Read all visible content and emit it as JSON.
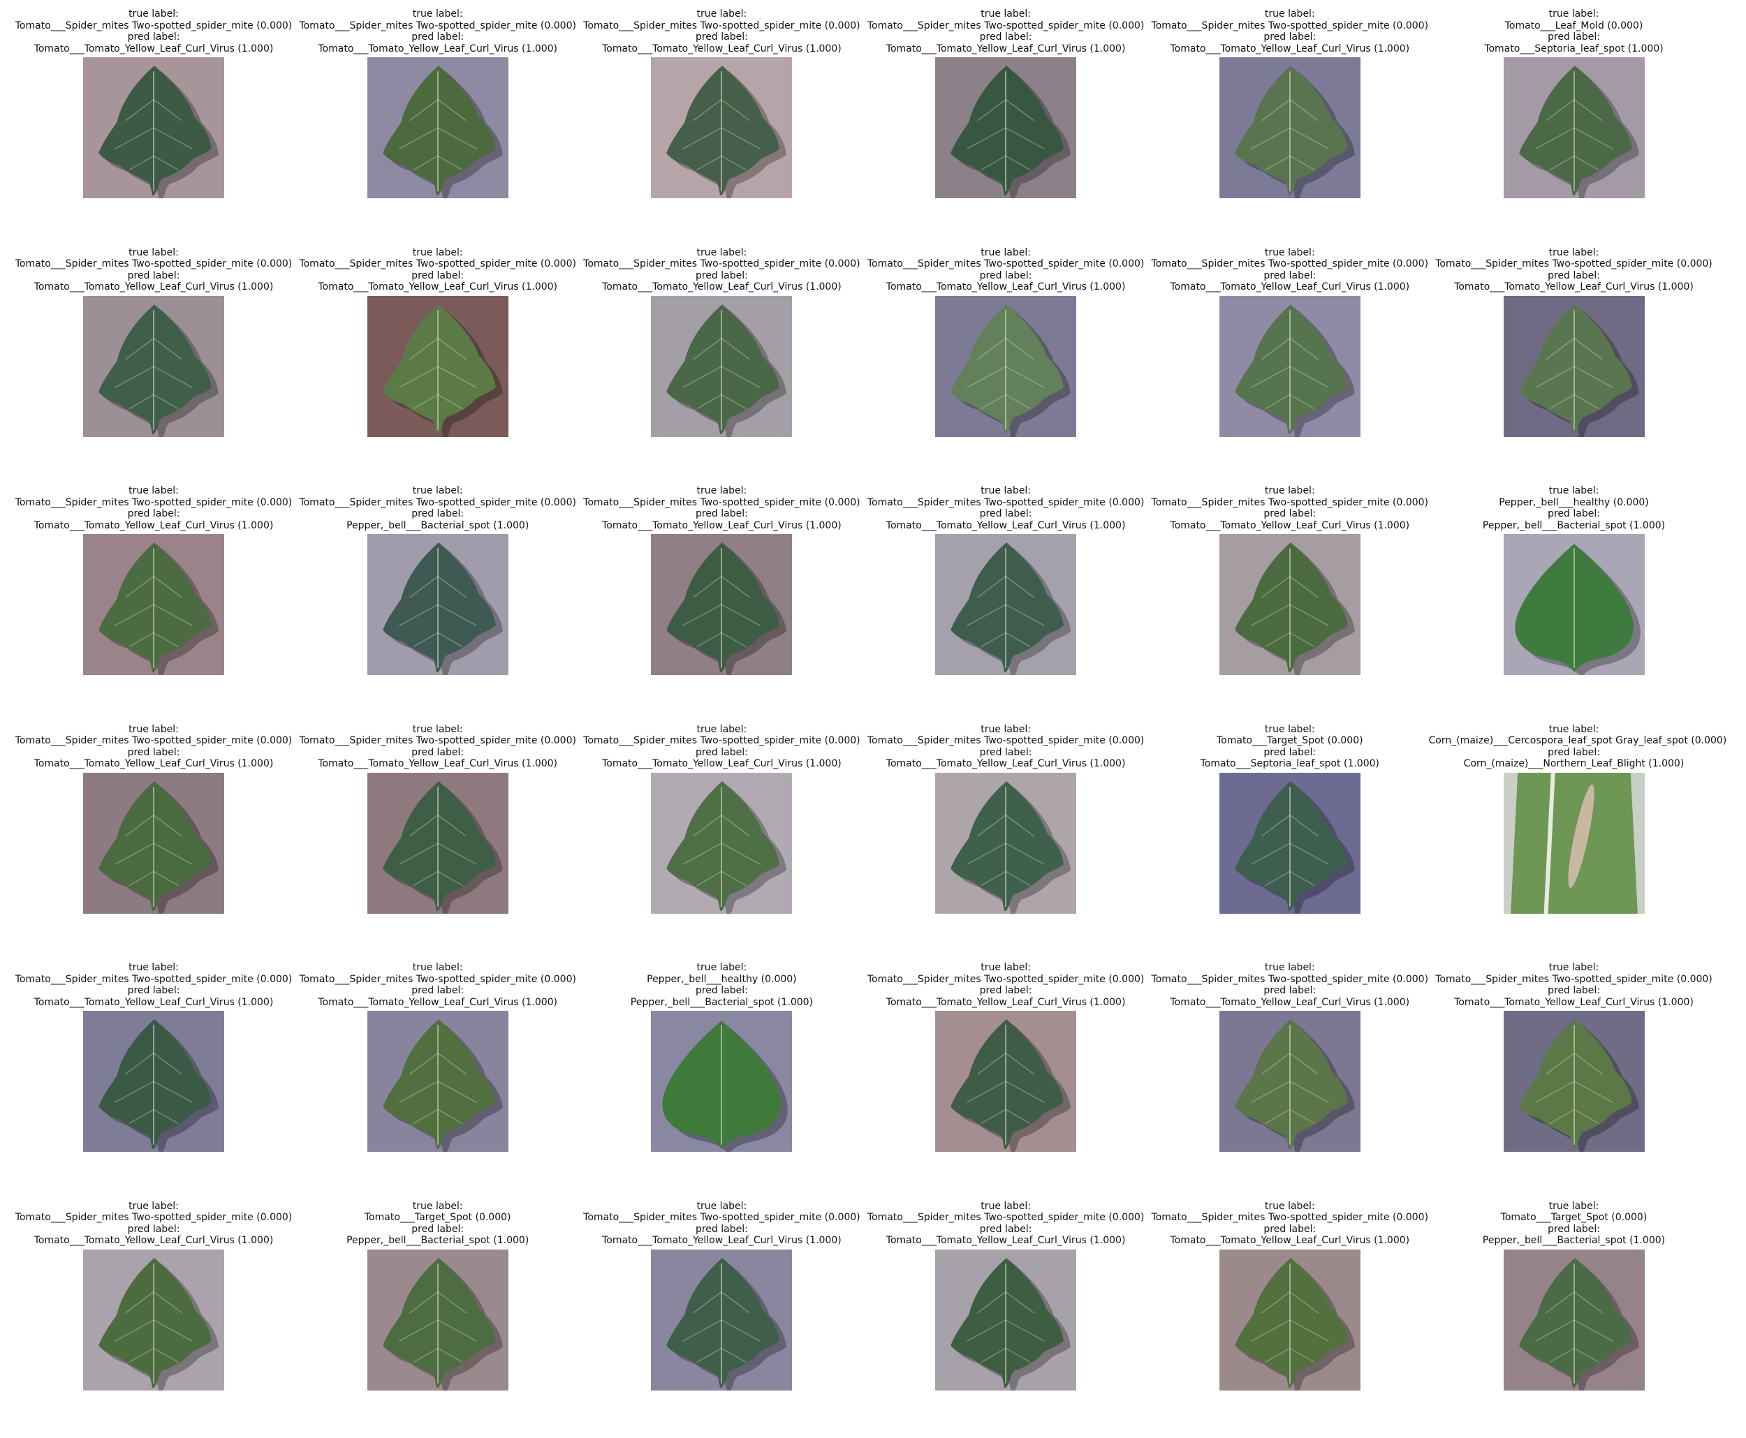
{
  "grid": {
    "cells": [
      {
        "true_hdr": "true label:",
        "true_label": "Tomato___Spider_mites Two-spotted_spider_mite (0.000)",
        "pred_hdr": "pred label:",
        "pred_label": "Tomato___Tomato_Yellow_Leaf_Curl_Virus (1.000)",
        "bg": "#a7959a",
        "leaf": "#3c5a44",
        "shape": "tomato"
      },
      {
        "true_hdr": "true label:",
        "true_label": "Tomato___Spider_mites Two-spotted_spider_mite (0.000)",
        "pred_hdr": "pred label:",
        "pred_label": "Tomato___Tomato_Yellow_Leaf_Curl_Virus (1.000)",
        "bg": "#8f8aa3",
        "leaf": "#4d6a3f",
        "shape": "tomato"
      },
      {
        "true_hdr": "true label:",
        "true_label": "Tomato___Spider_mites Two-spotted_spider_mite (0.000)",
        "pred_hdr": "pred label:",
        "pred_label": "Tomato___Tomato_Yellow_Leaf_Curl_Virus (1.000)",
        "bg": "#b6a5a8",
        "leaf": "#455f4a",
        "shape": "tomato"
      },
      {
        "true_hdr": "true label:",
        "true_label": "Tomato___Spider_mites Two-spotted_spider_mite (0.000)",
        "pred_hdr": "pred label:",
        "pred_label": "Tomato___Tomato_Yellow_Leaf_Curl_Virus (1.000)",
        "bg": "#8d8189",
        "leaf": "#385741",
        "shape": "tomato"
      },
      {
        "true_hdr": "true label:",
        "true_label": "Tomato___Spider_mites Two-spotted_spider_mite (0.000)",
        "pred_hdr": "pred label:",
        "pred_label": "Tomato___Tomato_Yellow_Leaf_Curl_Virus (1.000)",
        "bg": "#7c7a96",
        "leaf": "#5a7450",
        "shape": "tomato"
      },
      {
        "true_hdr": "true label:",
        "true_label": "Tomato___Leaf_Mold (0.000)",
        "pred_hdr": "pred label:",
        "pred_label": "Tomato___Septoria_leaf_spot (1.000)",
        "bg": "#a39aa6",
        "leaf": "#4b6946",
        "shape": "tomato"
      },
      {
        "true_hdr": "true label:",
        "true_label": "Tomato___Spider_mites Two-spotted_spider_mite (0.000)",
        "pred_hdr": "pred label:",
        "pred_label": "Tomato___Tomato_Yellow_Leaf_Curl_Virus (1.000)",
        "bg": "#9c8f96",
        "leaf": "#3f5f48",
        "shape": "tomato"
      },
      {
        "true_hdr": "true label:",
        "true_label": "Tomato___Spider_mites Two-spotted_spider_mite (0.000)",
        "pred_hdr": "pred label:",
        "pred_label": "Tomato___Tomato_Yellow_Leaf_Curl_Virus (1.000)",
        "bg": "#7b5a5a",
        "leaf": "#5c7a46",
        "shape": "tomato"
      },
      {
        "true_hdr": "true label:",
        "true_label": "Tomato___Spider_mites Two-spotted_spider_mite (0.000)",
        "pred_hdr": "pred label:",
        "pred_label": "Tomato___Tomato_Yellow_Leaf_Curl_Virus (1.000)",
        "bg": "#a49ea6",
        "leaf": "#4a6848",
        "shape": "tomato"
      },
      {
        "true_hdr": "true label:",
        "true_label": "Tomato___Spider_mites Two-spotted_spider_mite (0.000)",
        "pred_hdr": "pred label:",
        "pred_label": "Tomato___Tomato_Yellow_Leaf_Curl_Virus (1.000)",
        "bg": "#7d7a95",
        "leaf": "#62805a",
        "shape": "tomato"
      },
      {
        "true_hdr": "true label:",
        "true_label": "Tomato___Spider_mites Two-spotted_spider_mite (0.000)",
        "pred_hdr": "pred label:",
        "pred_label": "Tomato___Tomato_Yellow_Leaf_Curl_Virus (1.000)",
        "bg": "#8f8ba7",
        "leaf": "#56744d",
        "shape": "tomato"
      },
      {
        "true_hdr": "true label:",
        "true_label": "Tomato___Spider_mites Two-spotted_spider_mite (0.000)",
        "pred_hdr": "pred label:",
        "pred_label": "Tomato___Tomato_Yellow_Leaf_Curl_Virus (1.000)",
        "bg": "#6f6b85",
        "leaf": "#5a7650",
        "shape": "tomato"
      },
      {
        "true_hdr": "true label:",
        "true_label": "Tomato___Spider_mites Two-spotted_spider_mite (0.000)",
        "pred_hdr": "pred label:",
        "pred_label": "Tomato___Tomato_Yellow_Leaf_Curl_Virus (1.000)",
        "bg": "#9a8489",
        "leaf": "#4c6b42",
        "shape": "tomato"
      },
      {
        "true_hdr": "true label:",
        "true_label": "Tomato___Spider_mites Two-spotted_spider_mite (0.000)",
        "pred_hdr": "pred label:",
        "pred_label": "Pepper,_bell___Bacterial_spot (1.000)",
        "bg": "#a19cab",
        "leaf": "#3e5a52",
        "shape": "tomato"
      },
      {
        "true_hdr": "true label:",
        "true_label": "Tomato___Spider_mites Two-spotted_spider_mite (0.000)",
        "pred_hdr": "pred label:",
        "pred_label": "Tomato___Tomato_Yellow_Leaf_Curl_Virus (1.000)",
        "bg": "#907f86",
        "leaf": "#3d5c44",
        "shape": "tomato"
      },
      {
        "true_hdr": "true label:",
        "true_label": "Tomato___Spider_mites Two-spotted_spider_mite (0.000)",
        "pred_hdr": "pred label:",
        "pred_label": "Tomato___Tomato_Yellow_Leaf_Curl_Virus (1.000)",
        "bg": "#a5a1ac",
        "leaf": "#3f5d4f",
        "shape": "tomato"
      },
      {
        "true_hdr": "true label:",
        "true_label": "Tomato___Spider_mites Two-spotted_spider_mite (0.000)",
        "pred_hdr": "pred label:",
        "pred_label": "Tomato___Tomato_Yellow_Leaf_Curl_Virus (1.000)",
        "bg": "#a69da3",
        "leaf": "#4b6a40",
        "shape": "tomato"
      },
      {
        "true_hdr": "true label:",
        "true_label": "Pepper,_bell___healthy (0.000)",
        "pred_hdr": "pred label:",
        "pred_label": "Pepper,_bell___Bacterial_spot (1.000)",
        "bg": "#aaa6b5",
        "leaf": "#3f7a3e",
        "shape": "pepper"
      },
      {
        "true_hdr": "true label:",
        "true_label": "Tomato___Spider_mites Two-spotted_spider_mite (0.000)",
        "pred_hdr": "pred label:",
        "pred_label": "Tomato___Tomato_Yellow_Leaf_Curl_Virus (1.000)",
        "bg": "#8c7b82",
        "leaf": "#4a6a40",
        "shape": "tomato"
      },
      {
        "true_hdr": "true label:",
        "true_label": "Tomato___Spider_mites Two-spotted_spider_mite (0.000)",
        "pred_hdr": "pred label:",
        "pred_label": "Tomato___Tomato_Yellow_Leaf_Curl_Virus (1.000)",
        "bg": "#8e7a7e",
        "leaf": "#3e5e46",
        "shape": "tomato"
      },
      {
        "true_hdr": "true label:",
        "true_label": "Tomato___Spider_mites Two-spotted_spider_mite (0.000)",
        "pred_hdr": "pred label:",
        "pred_label": "Tomato___Tomato_Yellow_Leaf_Curl_Virus (1.000)",
        "bg": "#b1aab3",
        "leaf": "#4f6f46",
        "shape": "tomato"
      },
      {
        "true_hdr": "true label:",
        "true_label": "Tomato___Spider_mites Two-spotted_spider_mite (0.000)",
        "pred_hdr": "pred label:",
        "pred_label": "Tomato___Tomato_Yellow_Leaf_Curl_Virus (1.000)",
        "bg": "#aea5ab",
        "leaf": "#3f604d",
        "shape": "tomato"
      },
      {
        "true_hdr": "true label:",
        "true_label": "Tomato___Target_Spot (0.000)",
        "pred_hdr": "pred label:",
        "pred_label": "Tomato___Septoria_leaf_spot (1.000)",
        "bg": "#6e6b92",
        "leaf": "#3e5e4f",
        "shape": "tomato"
      },
      {
        "true_hdr": "true label:",
        "true_label": "Corn_(maize)___Cercospora_leaf_spot Gray_leaf_spot (0.000)",
        "pred_hdr": "pred label:",
        "pred_label": "Corn_(maize)___Northern_Leaf_Blight (1.000)",
        "bg": "#c9cfc6",
        "leaf": "#6e9655",
        "shape": "corn"
      },
      {
        "true_hdr": "true label:",
        "true_label": "Tomato___Spider_mites Two-spotted_spider_mite (0.000)",
        "pred_hdr": "pred label:",
        "pred_label": "Tomato___Tomato_Yellow_Leaf_Curl_Virus (1.000)",
        "bg": "#7f7c98",
        "leaf": "#3a5a45",
        "shape": "tomato"
      },
      {
        "true_hdr": "true label:",
        "true_label": "Tomato___Spider_mites Two-spotted_spider_mite (0.000)",
        "pred_hdr": "pred label:",
        "pred_label": "Tomato___Tomato_Yellow_Leaf_Curl_Virus (1.000)",
        "bg": "#88849e",
        "leaf": "#52703f",
        "shape": "tomato"
      },
      {
        "true_hdr": "true label:",
        "true_label": "Pepper,_bell___healthy (0.000)",
        "pred_hdr": "pred label:",
        "pred_label": "Pepper,_bell___Bacterial_spot (1.000)",
        "bg": "#8a87a3",
        "leaf": "#3f7a3a",
        "shape": "pepper"
      },
      {
        "true_hdr": "true label:",
        "true_label": "Tomato___Spider_mites Two-spotted_spider_mite (0.000)",
        "pred_hdr": "pred label:",
        "pred_label": "Tomato___Tomato_Yellow_Leaf_Curl_Virus (1.000)",
        "bg": "#a48e92",
        "leaf": "#3f5c47",
        "shape": "tomato"
      },
      {
        "true_hdr": "true label:",
        "true_label": "Tomato___Spider_mites Two-spotted_spider_mite (0.000)",
        "pred_hdr": "pred label:",
        "pred_label": "Tomato___Tomato_Yellow_Leaf_Curl_Virus (1.000)",
        "bg": "#7c7893",
        "leaf": "#5b7648",
        "shape": "tomato"
      },
      {
        "true_hdr": "true label:",
        "true_label": "Tomato___Spider_mites Two-spotted_spider_mite (0.000)",
        "pred_hdr": "pred label:",
        "pred_label": "Tomato___Tomato_Yellow_Leaf_Curl_Virus (1.000)",
        "bg": "#6f6c86",
        "leaf": "#5c7846",
        "shape": "tomato"
      },
      {
        "true_hdr": "true label:",
        "true_label": "Tomato___Spider_mites Two-spotted_spider_mite (0.000)",
        "pred_hdr": "pred label:",
        "pred_label": "Tomato___Tomato_Yellow_Leaf_Curl_Virus (1.000)",
        "bg": "#aaa3ab",
        "leaf": "#4c6c3f",
        "shape": "tomato"
      },
      {
        "true_hdr": "true label:",
        "true_label": "Tomato___Target_Spot (0.000)",
        "pred_hdr": "pred label:",
        "pred_label": "Pepper,_bell___Bacterial_spot (1.000)",
        "bg": "#9a8a8e",
        "leaf": "#4e6c42",
        "shape": "tomato"
      },
      {
        "true_hdr": "true label:",
        "true_label": "Tomato___Spider_mites Two-spotted_spider_mite (0.000)",
        "pred_hdr": "pred label:",
        "pred_label": "Tomato___Tomato_Yellow_Leaf_Curl_Virus (1.000)",
        "bg": "#8a86a0",
        "leaf": "#3f5f4b",
        "shape": "tomato"
      },
      {
        "true_hdr": "true label:",
        "true_label": "Tomato___Spider_mites Two-spotted_spider_mite (0.000)",
        "pred_hdr": "pred label:",
        "pred_label": "Tomato___Tomato_Yellow_Leaf_Curl_Virus (1.000)",
        "bg": "#a7a1aa",
        "leaf": "#3d5e40",
        "shape": "tomato"
      },
      {
        "true_hdr": "true label:",
        "true_label": "Tomato___Spider_mites Two-spotted_spider_mite (0.000)",
        "pred_hdr": "pred label:",
        "pred_label": "Tomato___Tomato_Yellow_Leaf_Curl_Virus (1.000)",
        "bg": "#9c898c",
        "leaf": "#53703f",
        "shape": "tomato"
      },
      {
        "true_hdr": "true label:",
        "true_label": "Tomato___Target_Spot (0.000)",
        "pred_hdr": "pred label:",
        "pred_label": "Pepper,_bell___Bacterial_spot (1.000)",
        "bg": "#968389",
        "leaf": "#4a6b45",
        "shape": "tomato"
      }
    ]
  }
}
